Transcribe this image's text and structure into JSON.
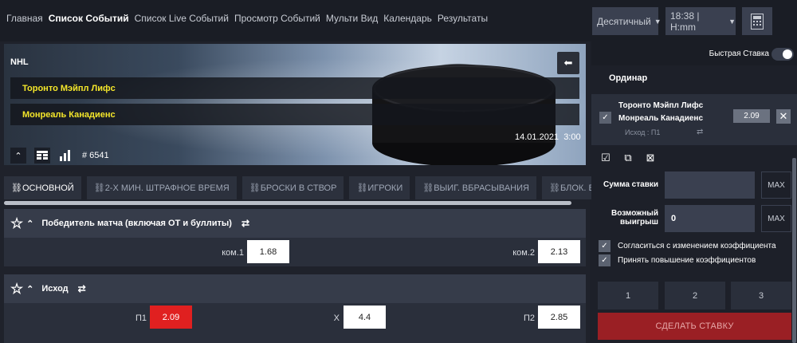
{
  "nav": {
    "items": [
      "Главная",
      "Список Событий",
      "Список Live Событий",
      "Просмотр Событий",
      "Мульти Вид",
      "Календарь",
      "Результаты"
    ],
    "active_index": 1
  },
  "controls": {
    "odds_format": "Десятичный",
    "time": "18:38 | H:mm",
    "calculator_icon": "calculator-icon"
  },
  "event": {
    "league": "NHL",
    "team1": "Торонто Мэйпл Лифс",
    "team2": "Монреаль Канадиенс",
    "date": "14.01.2021",
    "time": "3:00",
    "event_number": "# 6541"
  },
  "tabs": [
    "ОСНОВНОЙ",
    "2-Х МИН. ШТРАФНОЕ ВРЕМЯ",
    "БРОСКИ В СТВОР",
    "ИГРОКИ",
    "ВЫИГ. ВБРАСЫВАНИЯ",
    "БЛОК. В"
  ],
  "markets": [
    {
      "title": "Победитель матча (включая ОТ и буллиты)",
      "outcomes": [
        {
          "label": "ком.1",
          "odd": "1.68"
        },
        {
          "label": "ком.2",
          "odd": "2.13"
        }
      ]
    },
    {
      "title": "Исход",
      "outcomes": [
        {
          "label": "П1",
          "odd": "2.09",
          "selected": true
        },
        {
          "label": "X",
          "odd": "4.4"
        },
        {
          "label": "П2",
          "odd": "2.85"
        }
      ]
    }
  ],
  "betslip": {
    "quick_bet_label": "Быстрая Ставка",
    "type": "Ординар",
    "slip": {
      "team1": "Торонто Мэйпл Лифс",
      "team2": "Монреаль Канадиенс",
      "outcome": "Исход : П1",
      "odd": "2.09"
    },
    "stake_label": "Сумма ставки",
    "stake_value": "",
    "max_label": "MAX",
    "win_label_1": "Возможный",
    "win_label_2": "выигрыш",
    "win_value": "0",
    "accept_changes": "Согласиться с изменением коэффициента",
    "accept_increase": "Принять повышение коэффициентов",
    "quick_amounts": [
      "1",
      "2",
      "3"
    ],
    "place_button": "СДЕЛАТЬ СТАВКУ"
  },
  "colors": {
    "accent_yellow": "#f5e72a",
    "selected_red": "#e02020",
    "place_button": "#9a1f24"
  }
}
